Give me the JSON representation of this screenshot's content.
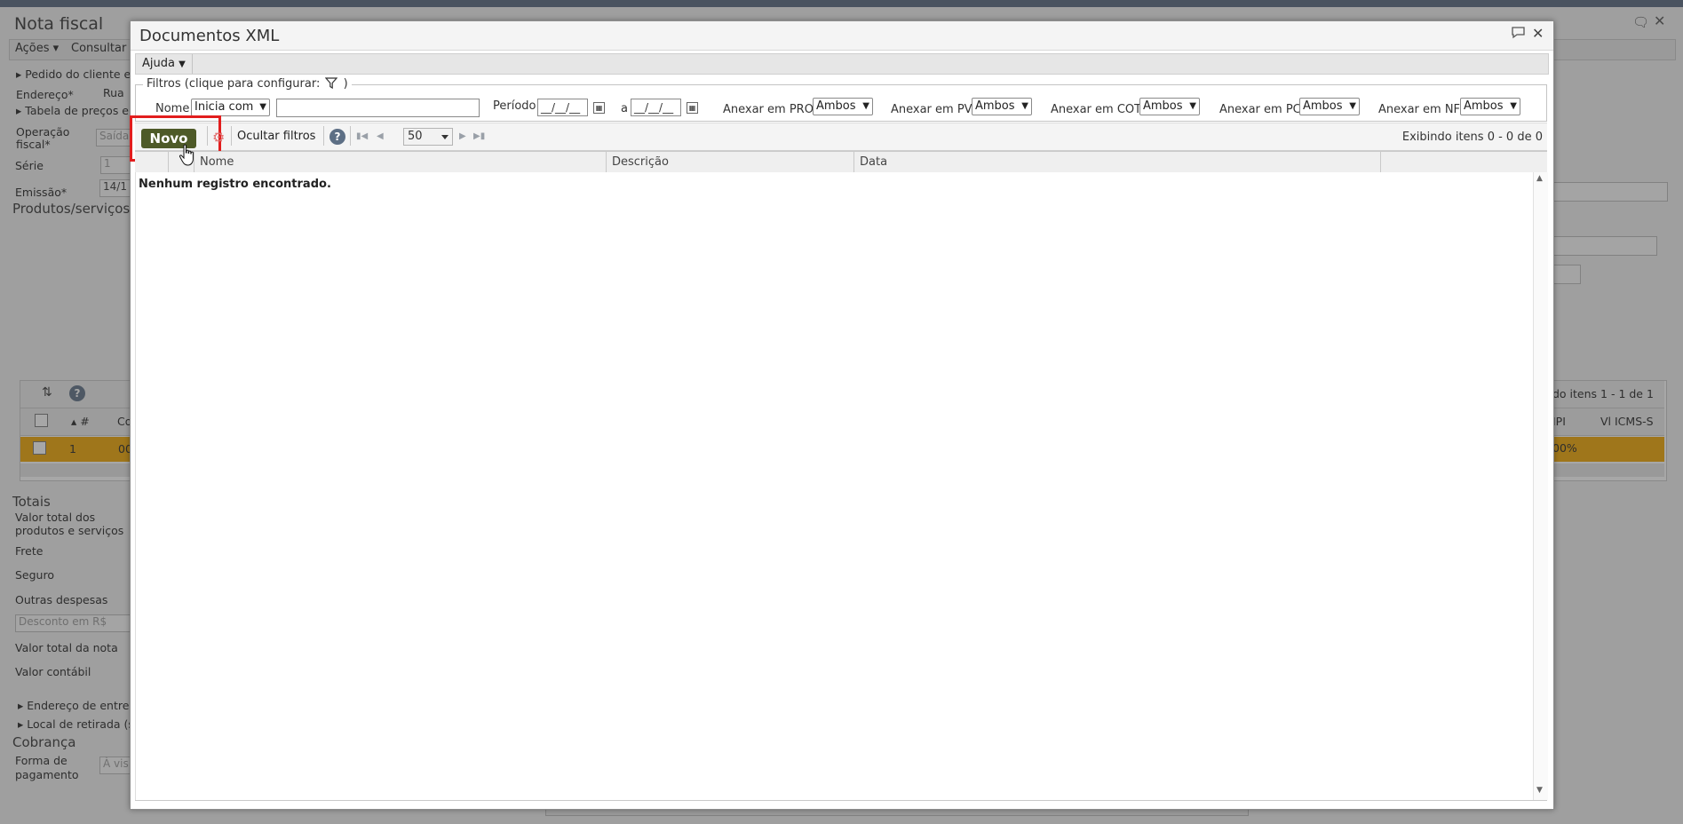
{
  "background": {
    "title": "Nota fiscal",
    "menu": [
      "Ações",
      "Consultar"
    ],
    "labels": {
      "pedido": "Pedido do cliente e",
      "endereco": "Endereço*",
      "endereco_val": "Rua",
      "tabela": "Tabela de preços e",
      "operacao_1": "Operação",
      "operacao_2": "fiscal*",
      "operacao_val": "Saída",
      "serie": "Série",
      "serie_val": "1",
      "emissao": "Emissão*",
      "emissao_val": "14/1",
      "produtos": "Produtos/serviços",
      "grid_hash": "#",
      "grid_co": "Co",
      "row_num": "1",
      "row_code": "00",
      "itens": "do itens 1 - 1 de 1",
      "col_ipi": "IPI",
      "col_vl": "Vl ICMS-S",
      "row_pct": "00%",
      "totais": "Totais",
      "valor_total_1": "Valor total dos",
      "valor_total_2": "produtos e serviços",
      "frete": "Frete",
      "seguro": "Seguro",
      "outras": "Outras despesas",
      "desconto": "Desconto em R$",
      "valor_nota": "Valor total da nota",
      "valor_contabil": "Valor contábil",
      "end_entrega": "Endereço de entreg",
      "local_retirada": "Local de retirada (s",
      "cobranca": "Cobrança",
      "forma_1": "Forma de",
      "forma_2": "pagamento",
      "forma_val": "À vis"
    }
  },
  "modal": {
    "title": "Documentos XML",
    "menu": {
      "ajuda": "Ajuda"
    },
    "filters": {
      "legend": "Filtros (clique para configurar:",
      "legend_close": ")",
      "nome_label": "Nome",
      "nome_mode": "Inicia com",
      "nome_value": "",
      "periodo_label": "Período",
      "date_from": "__/__/__",
      "a_label": "a",
      "date_to": "__/__/__",
      "anexar_pro_label": "Anexar em PRO",
      "anexar_pro": "Ambos",
      "anexar_pv_label": "Anexar em PV",
      "anexar_pv": "Ambos",
      "anexar_cot_label": "Anexar em COT",
      "anexar_cot": "Ambos",
      "anexar_pc_label": "Anexar em PC",
      "anexar_pc": "Ambos",
      "anexar_nf_label": "Anexar em NF",
      "anexar_nf": "Ambos"
    },
    "toolbar": {
      "novo": "Novo",
      "ocultar_filtros": "Ocultar filtros",
      "page_size": "50",
      "exibindo": "Exibindo itens 0 - 0 de 0"
    },
    "grid": {
      "columns": [
        "Nome",
        "Descrição",
        "Data"
      ],
      "empty": "Nenhum registro encontrado."
    }
  },
  "colors": {
    "novo_button": "#4e5a28",
    "highlight": "#e21d1d",
    "row_highlight": "#f0a600"
  }
}
